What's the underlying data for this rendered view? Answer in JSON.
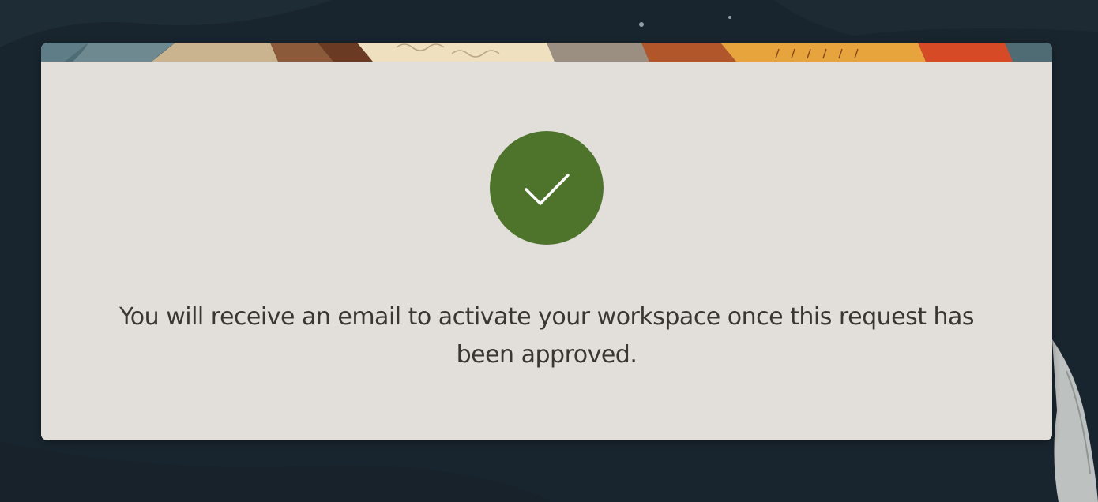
{
  "theme": {
    "page_background": "#19252e",
    "card_background": "#e2dfda",
    "success_color": "#4e742c",
    "check_color": "#ffffff",
    "text_color": "#3a3632",
    "banner_palette": [
      "#5f7d86",
      "#c9b48f",
      "#6a3a22",
      "#efe0bf",
      "#9a8f80",
      "#b0562a",
      "#e8a43c",
      "#d64a26",
      "#4f6b74"
    ]
  },
  "status": {
    "icon": "checkmark-icon",
    "state": "success"
  },
  "message": {
    "text": "You will receive an email to activate your workspace once this request has been approved."
  }
}
